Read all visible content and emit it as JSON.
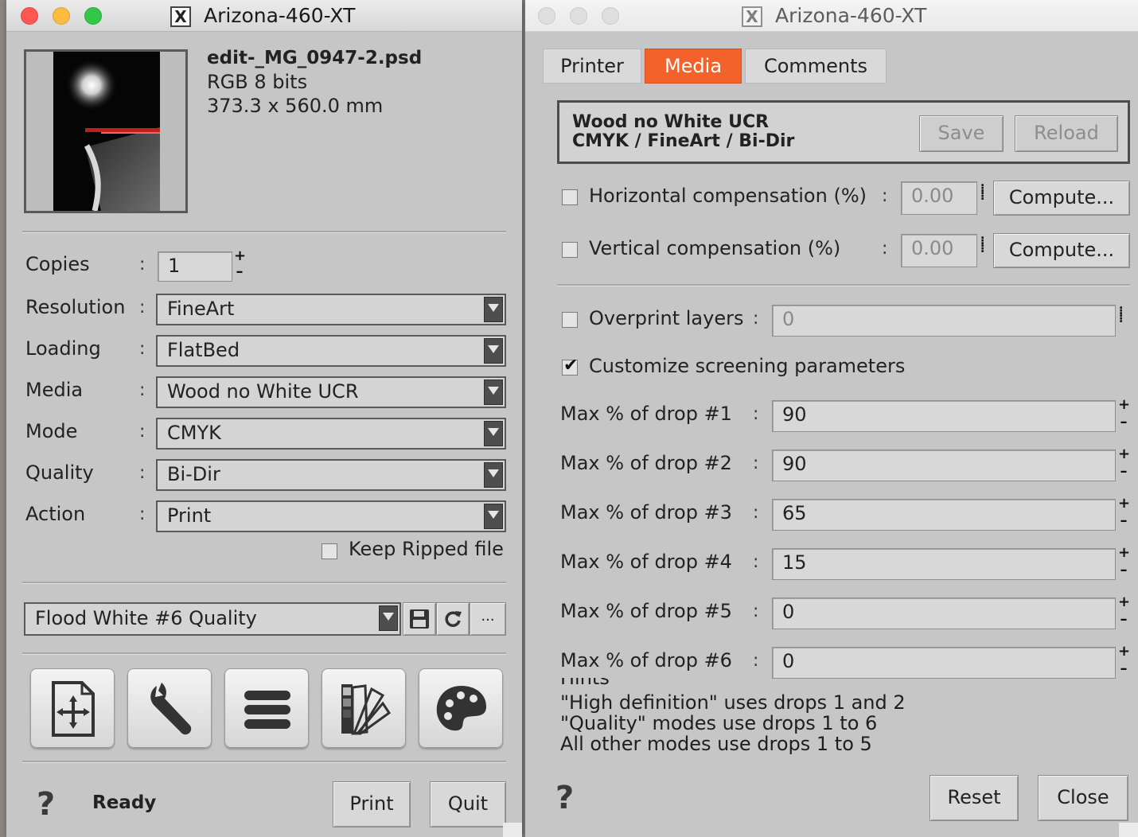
{
  "window1": {
    "title": "Arizona-460-XT",
    "file": {
      "name": "edit-_MG_0947-2.psd",
      "color": "RGB 8 bits",
      "size": "373.3 x 560.0 mm"
    },
    "copies": {
      "label": "Copies",
      "value": "1"
    },
    "resolution": {
      "label": "Resolution",
      "value": "FineArt"
    },
    "loading": {
      "label": "Loading",
      "value": "FlatBed"
    },
    "media": {
      "label": "Media",
      "value": "Wood no White UCR"
    },
    "mode": {
      "label": "Mode",
      "value": "CMYK"
    },
    "quality": {
      "label": "Quality",
      "value": "Bi-Dir"
    },
    "action": {
      "label": "Action",
      "value": "Print"
    },
    "colon": ":",
    "keep_ripped": {
      "label": "Keep Ripped file",
      "checked": false
    },
    "preset": {
      "value": "Flood White #6 Quality",
      "more": "..."
    },
    "toolbar_icons": [
      "move-file-icon",
      "wrench-icon",
      "menu-lines-icon",
      "color-swatch-icon",
      "palette-icon"
    ],
    "help": "?",
    "status": "Ready",
    "print_label": "Print",
    "quit_label": "Quit"
  },
  "window2": {
    "title": "Arizona-460-XT",
    "tabs": [
      {
        "label": "Printer",
        "active": false
      },
      {
        "label": "Media",
        "active": true
      },
      {
        "label": "Comments",
        "active": false
      }
    ],
    "media_line1": "Wood no White UCR",
    "media_line2": "CMYK / FineArt / Bi-Dir",
    "save_label": "Save",
    "reload_label": "Reload",
    "colon": ":",
    "horizontal": {
      "label": "Horizontal compensation (%)",
      "value": "0.00",
      "checked": false,
      "compute": "Compute..."
    },
    "vertical": {
      "label": "Vertical compensation (%)",
      "value": "0.00",
      "checked": false,
      "compute": "Compute..."
    },
    "overprint": {
      "label": "Overprint layers",
      "value": "0",
      "checked": false
    },
    "customize": {
      "label": "Customize screening parameters",
      "checked": true
    },
    "drops": [
      {
        "label": "Max % of drop #1",
        "value": "90"
      },
      {
        "label": "Max % of drop #2",
        "value": "90"
      },
      {
        "label": "Max % of drop #3",
        "value": "65"
      },
      {
        "label": "Max % of drop #4",
        "value": "15"
      },
      {
        "label": "Max % of drop #5",
        "value": "0"
      },
      {
        "label": "Max % of drop #6",
        "value": "0"
      }
    ],
    "hints_title": "Hints",
    "hints": [
      "\"High definition\" uses drops 1 and 2",
      "\"Quality\" modes use drops 1 to 6",
      "All other modes use drops 1 to 5"
    ],
    "help": "?",
    "reset_label": "Reset",
    "close_label": "Close"
  },
  "colors": {
    "accent": "#f2622a",
    "window_bg": "#c6c6c6",
    "field_bg": "#d4d4d4"
  }
}
